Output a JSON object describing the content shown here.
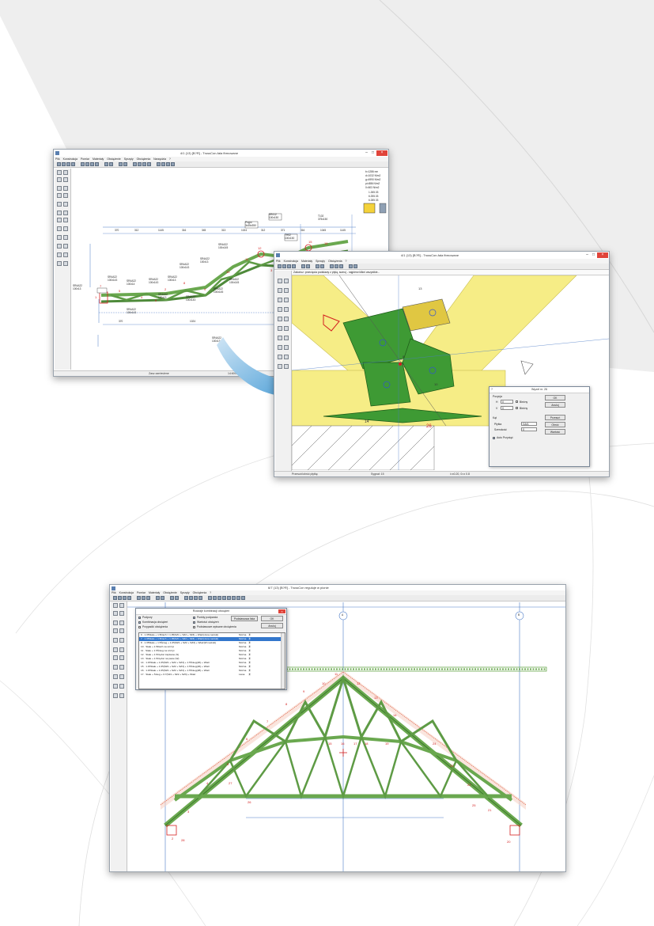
{
  "colors": {
    "page_bg": "#ffffff",
    "deco": "#eeeeee",
    "truss_green": "#6aa84f",
    "plate_green": "#3e9a34",
    "timber_yellow": "#f6ed86",
    "load_red": "#e06a50",
    "select_blue": "#3377cc",
    "close_red": "#e0443a"
  },
  "window1": {
    "title": "4/1 (13) [B?R] - TrussCon-fala fbrnowane",
    "menu": [
      "Plik",
      "Konstrukcja",
      "Pomiar",
      "Materiały",
      "Obciążenie",
      "Sprzęty",
      "Obciążenia",
      "Narzędzia",
      "?"
    ],
    "status": {
      "left": "Zasz zarrieslene",
      "right": "14:6006 2015"
    },
    "panel_values": [
      "b=1286 nm",
      "d=1032 N/m2",
      "g=4990 N/m2",
      "pi=886 N/m2",
      "0=603 N/m2",
      "1.265.33",
      "6.255.33",
      "6.285.33"
    ],
    "dims": [
      "370",
      "312",
      "1145",
      "316",
      "345",
      "313",
      "1024",
      "312",
      "371",
      "316",
      "1045",
      "1145",
      "370",
      "1024"
    ],
    "member_labels": [
      "SR4A22 100x13",
      "SR4A22 100x143",
      "SR4A22 100x14",
      "SR4A22 100x143",
      "SR4A22 100x13",
      "SR4A22 100x143",
      "SR4A22 100x13",
      "SR4A22 100x145",
      "SR4A22 100x13",
      "SR4A22 100x143",
      "SR4A22 100x145",
      "SR4A22 100x145",
      "SR4A22 100x143",
      "SR4A22 100x13"
    ],
    "top_labels": [
      "Prąpo 3x35x350",
      "SR412 100x150",
      "TH02 100x150",
      "T102 375x150"
    ],
    "node_numbers": [
      "7",
      "5",
      "4",
      "2",
      "8",
      "9",
      "10",
      "11",
      "12",
      "3",
      "13",
      "14",
      "15",
      "16",
      "1",
      "6"
    ]
  },
  "window2": {
    "title": "4/1 (13) [B?R] - TrussCon-fala fbrnowane",
    "menu": [
      "Plik",
      "Konstrukcja",
      "Materiały",
      "Sprzęty",
      "Obciążenia",
      "?"
    ],
    "info": "Zakończ: przecięcia podstawy z płytą, sumuj - najpierw klikni wszystkie...",
    "node_numbers": [
      "14",
      "26",
      "9",
      "13",
      "10"
    ],
    "status": {
      "left": "Przesuń/obróć płytkę",
      "mid": "Sygnał: 15",
      "right": "i=x0.20, 0=x 0.8"
    },
    "dialog": {
      "title": "Węzeł nr. 26",
      "question": "?",
      "group_pos": "Pozycja",
      "label_h": "H",
      "value_h": "0",
      "label_v": "V",
      "value_v": "0",
      "unit_h": "Bieżny",
      "unit_v": "Bieżny",
      "group_rot": "Kąt",
      "label_plytka": "Płytka",
      "value_plytka": "GA/1",
      "label_szer": "Szerokość",
      "value_szer": "0",
      "ok": "OK",
      "anuluj": "Anuluj",
      "btn3": "Przesuń",
      "btn4": "Obróć",
      "btn5": "Wartość",
      "auto": "Auto Przyciąć"
    }
  },
  "window3": {
    "title": "6/7 (13) [B?R] - TrussCon reguluje w pionie",
    "menu": [
      "Plik",
      "Konstrukcja",
      "Pomiar",
      "Materiały",
      "Obciążenie",
      "Sprzęty",
      "Obciążenia",
      "?"
    ],
    "grid_markers": [
      "A",
      "B"
    ],
    "node_numbers": [
      "2",
      "3",
      "4",
      "5",
      "6",
      "7",
      "8",
      "9",
      "10",
      "11",
      "12",
      "13",
      "14",
      "15",
      "16",
      "17",
      "18",
      "19",
      "20",
      "21",
      "22",
      "23",
      "24",
      "25",
      "26",
      "27",
      "28"
    ],
    "dialog": {
      "title": "Rodzaje kombinacji obciążeń",
      "checks_left": [
        {
          "label": "Podpory",
          "on": true
        },
        {
          "label": "Kombinacja obciążeń",
          "on": true
        },
        {
          "label": "Przypadki obciążenia",
          "on": false
        }
      ],
      "checks_right": [
        {
          "label": "Punkty podparcia",
          "on": true
        },
        {
          "label": "Wartości obciążeń",
          "on": true
        },
        {
          "label": "Podstawowe wpisane obciążenia",
          "on": false
        }
      ],
      "btn_more": "Podstawowa lista",
      "ok": "OK",
      "anuluj": "Anuluj",
      "rows": [
        {
          "text": "9 · 1.35Stałe + 1.5Dach = 1.05(SZ1 + SZ2 + SZ3) + Wiatr(Jona naciski)",
          "status": "Można",
          "x": "Ⓡ",
          "sel": false
        },
        {
          "text": "7 · 1.35Stałe + 1.5Dach + 1.05(SZ1 + SZ2 + SZ3) + Wiatr(Jona naciski)",
          "status": "Można",
          "x": "Ⓡ",
          "sel": true
        },
        {
          "text": "8 · 1.35Stałe + 1.5Śnieg + 1.05(SZ1 + SZ2 + SZ3) + Wiatr(W naciski)",
          "status": "Można",
          "x": "Ⓡ",
          "sel": false
        },
        {
          "text": "10 · Stałe + 1.5Dach na szczyt",
          "status": "Można",
          "x": "Ⓡ",
          "sel": false
        },
        {
          "text": "11 · Stałe + 1.5Śnieg na szczyt",
          "status": "Można",
          "x": "Ⓡ",
          "sel": false
        },
        {
          "text": "12 · Stałe + 1.5Ciężar zapisane (S)",
          "status": "Można",
          "x": "Ⓡ",
          "sel": false
        },
        {
          "text": "13 · Stałe + 1.5Ciężar na pasie (W)",
          "status": "Można",
          "x": "Ⓡ",
          "sel": false
        },
        {
          "text": "14 · 1.15Stałe + 1.05(SZ1 + SZ2 + SZ3) + 1.5Śnieg(20) + Wiatr",
          "status": "Można",
          "x": "Ⓡ",
          "sel": false
        },
        {
          "text": "15 · 1.15Stałe + 1.05(SZ1 + SZ2 + SZ3) + 1.5Śnieg(26) + Wiatr",
          "status": "Można",
          "x": "Ⓡ",
          "sel": false
        },
        {
          "text": "16 · 1.15Stałe + 1.05(SZ1 + SZ2 + SZ3) + 1.5Śnieg(28) + Wiatr",
          "status": "Można",
          "x": "Ⓡ",
          "sel": false
        },
        {
          "text": "17 · Stałe + Śnieg + 0.7(SZ1 + SZ2 + SZ3) + Wiatr",
          "status": "Liesa",
          "x": "Ⓡ",
          "sel": false
        }
      ]
    }
  }
}
